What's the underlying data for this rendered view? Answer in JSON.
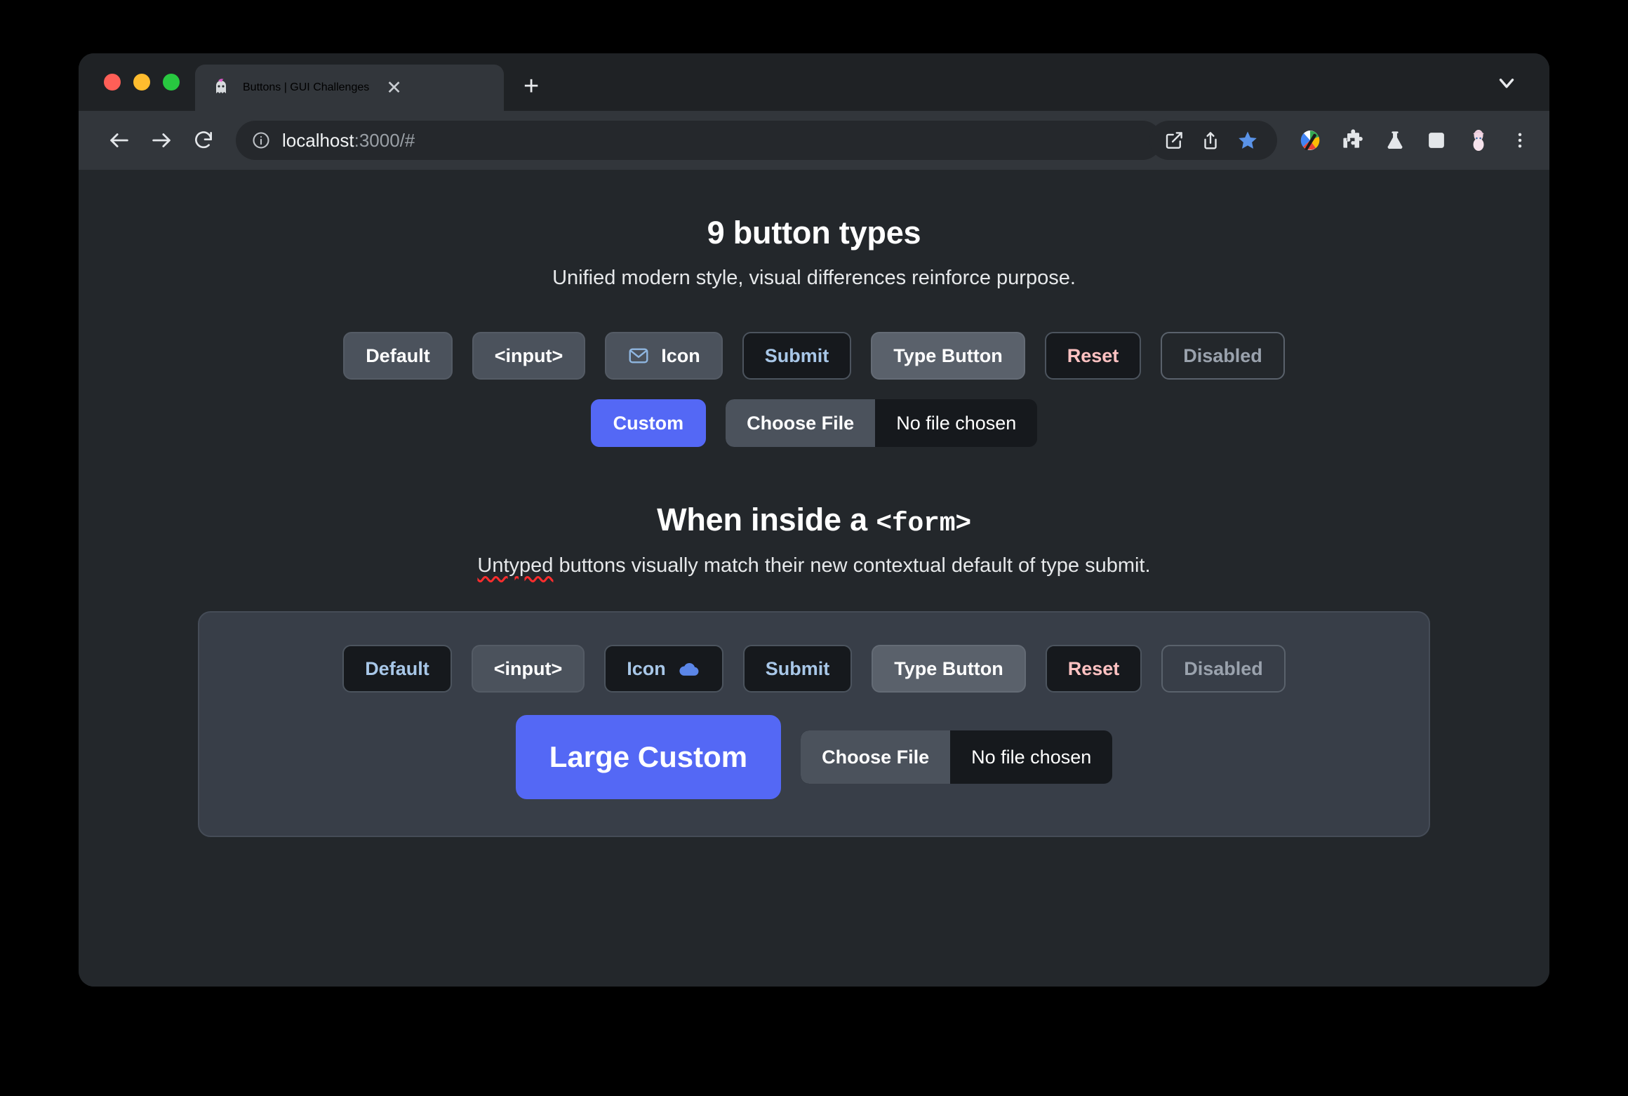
{
  "browser": {
    "tab": {
      "title": "Buttons | GUI Challenges",
      "favicon": "ghost-favicon",
      "close_label": "✕"
    },
    "new_tab_label": "+",
    "omnibox": {
      "url_host": "localhost",
      "url_rest": ":3000/#",
      "site_info_icon": "info-icon"
    },
    "toolbar_icons": [
      "back-icon",
      "forward-icon",
      "reload-icon",
      "open-in-new-icon",
      "share-icon",
      "bookmark-star-icon",
      "palette-extension-icon",
      "puzzle-extensions-icon",
      "labs-flask-icon",
      "side-panel-icon",
      "profile-avatar-icon",
      "three-dot-menu-icon"
    ],
    "accent_bookmark_color": "#5a93e8"
  },
  "page": {
    "background_color": "#23272b",
    "accent_color": "#5468f5",
    "sections": [
      {
        "title": "9 button types",
        "subtitle": "Unified modern style, visual differences reinforce purpose.",
        "rows": [
          {
            "buttons": [
              {
                "label": "Default",
                "style": "default"
              },
              {
                "label": "<input>",
                "style": "input"
              },
              {
                "label": "Icon",
                "style": "icon",
                "icon": "envelope-icon",
                "icon_position": "left"
              },
              {
                "label": "Submit",
                "style": "submit"
              },
              {
                "label": "Type Button",
                "style": "type"
              },
              {
                "label": "Reset",
                "style": "reset"
              },
              {
                "label": "Disabled",
                "style": "disabled"
              }
            ]
          },
          {
            "buttons": [
              {
                "label": "Custom",
                "style": "custom"
              }
            ],
            "file_input": {
              "button_label": "Choose File",
              "status_label": "No file chosen"
            }
          }
        ]
      },
      {
        "title_prefix": "When inside a ",
        "title_tag": "<form>",
        "subtitle_misspelled": "Untyped",
        "subtitle_rest": " buttons visually match their new contextual default of type submit.",
        "rows": [
          {
            "buttons": [
              {
                "label": "Default",
                "style": "form-default"
              },
              {
                "label": "<input>",
                "style": "input"
              },
              {
                "label": "Icon",
                "style": "form-icon",
                "icon": "cloud-icon",
                "icon_position": "right"
              },
              {
                "label": "Submit",
                "style": "submit"
              },
              {
                "label": "Type Button",
                "style": "type"
              },
              {
                "label": "Reset",
                "style": "reset"
              },
              {
                "label": "Disabled",
                "style": "disabled"
              }
            ]
          },
          {
            "buttons": [
              {
                "label": "Large Custom",
                "style": "custom-large"
              }
            ],
            "file_input": {
              "button_label": "Choose File",
              "status_label": "No file chosen"
            }
          }
        ]
      }
    ]
  }
}
